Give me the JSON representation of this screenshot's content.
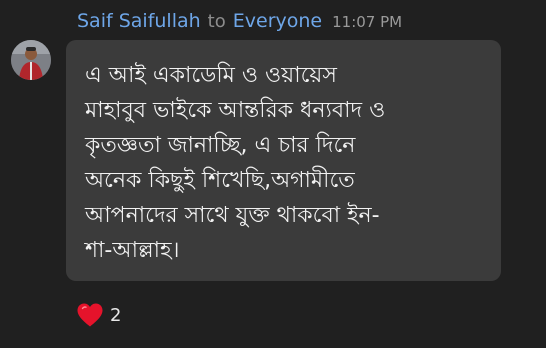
{
  "message": {
    "sender": "Saif Saifullah",
    "to_word": "to",
    "recipient": "Everyone",
    "time": "11:07 PM",
    "lines": [
      "এ আই একাডেমি  ও ওয়ায়েস",
      "মাহাবুব ভাইকে আন্তরিক ধন্যবাদ ও",
      "কৃতজ্ঞতা জানাচ্ছি, এ চার দিনে",
      "অনেক কিছুই শিখেছি,অগামীতে",
      "আপনাদের সাথে যুক্ত থাকবো ইন-",
      "শা-আল্লাহ।"
    ]
  },
  "reactions": [
    {
      "icon": "heart-icon",
      "count": "2",
      "color": "#e5132b"
    }
  ],
  "colors": {
    "background": "#202020",
    "bubble": "#3b3b3b",
    "name": "#6ea6e8"
  }
}
